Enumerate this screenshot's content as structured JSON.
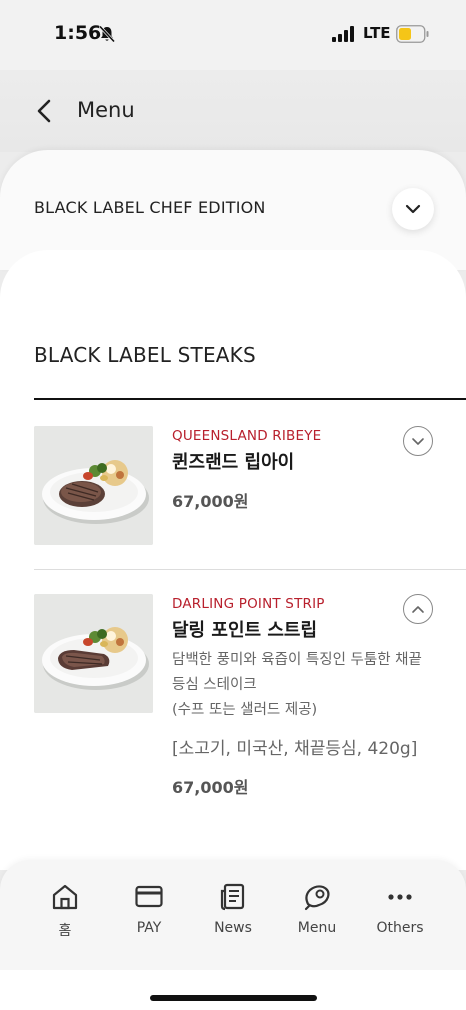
{
  "status_bar": {
    "time": "1:56",
    "network": "LTE",
    "battery_color": "#f5c518"
  },
  "header": {
    "title": "Menu"
  },
  "category": {
    "label": "BLACK LABEL CHEF EDITION"
  },
  "section": {
    "title": "BLACK LABEL STEAKS"
  },
  "items": [
    {
      "name_en": "QUEENSLAND RIBEYE",
      "name_ko": "퀸즈랜드 립아이",
      "price": "67,000원",
      "expanded": false
    },
    {
      "name_en": "DARLING POINT STRIP",
      "name_ko": "달링 포인트 스트립",
      "desc_line1": "담백한 풍미와 육즙이 특징인 두툼한 채끝",
      "desc_line2": "등심 스테이크",
      "desc_line3": "(수프 또는 샐러드 제공)",
      "origin": "[소고기, 미국산, 채끝등심, 420g]",
      "price": "67,000원",
      "expanded": true
    }
  ],
  "tabs": [
    {
      "label": "홈",
      "icon": "home-icon"
    },
    {
      "label": "PAY",
      "icon": "card-icon"
    },
    {
      "label": "News",
      "icon": "news-icon"
    },
    {
      "label": "Menu",
      "icon": "steak-icon"
    },
    {
      "label": "Others",
      "icon": "more-icon"
    }
  ],
  "colors": {
    "accent_red": "#b8202d",
    "background": "#ececec"
  }
}
